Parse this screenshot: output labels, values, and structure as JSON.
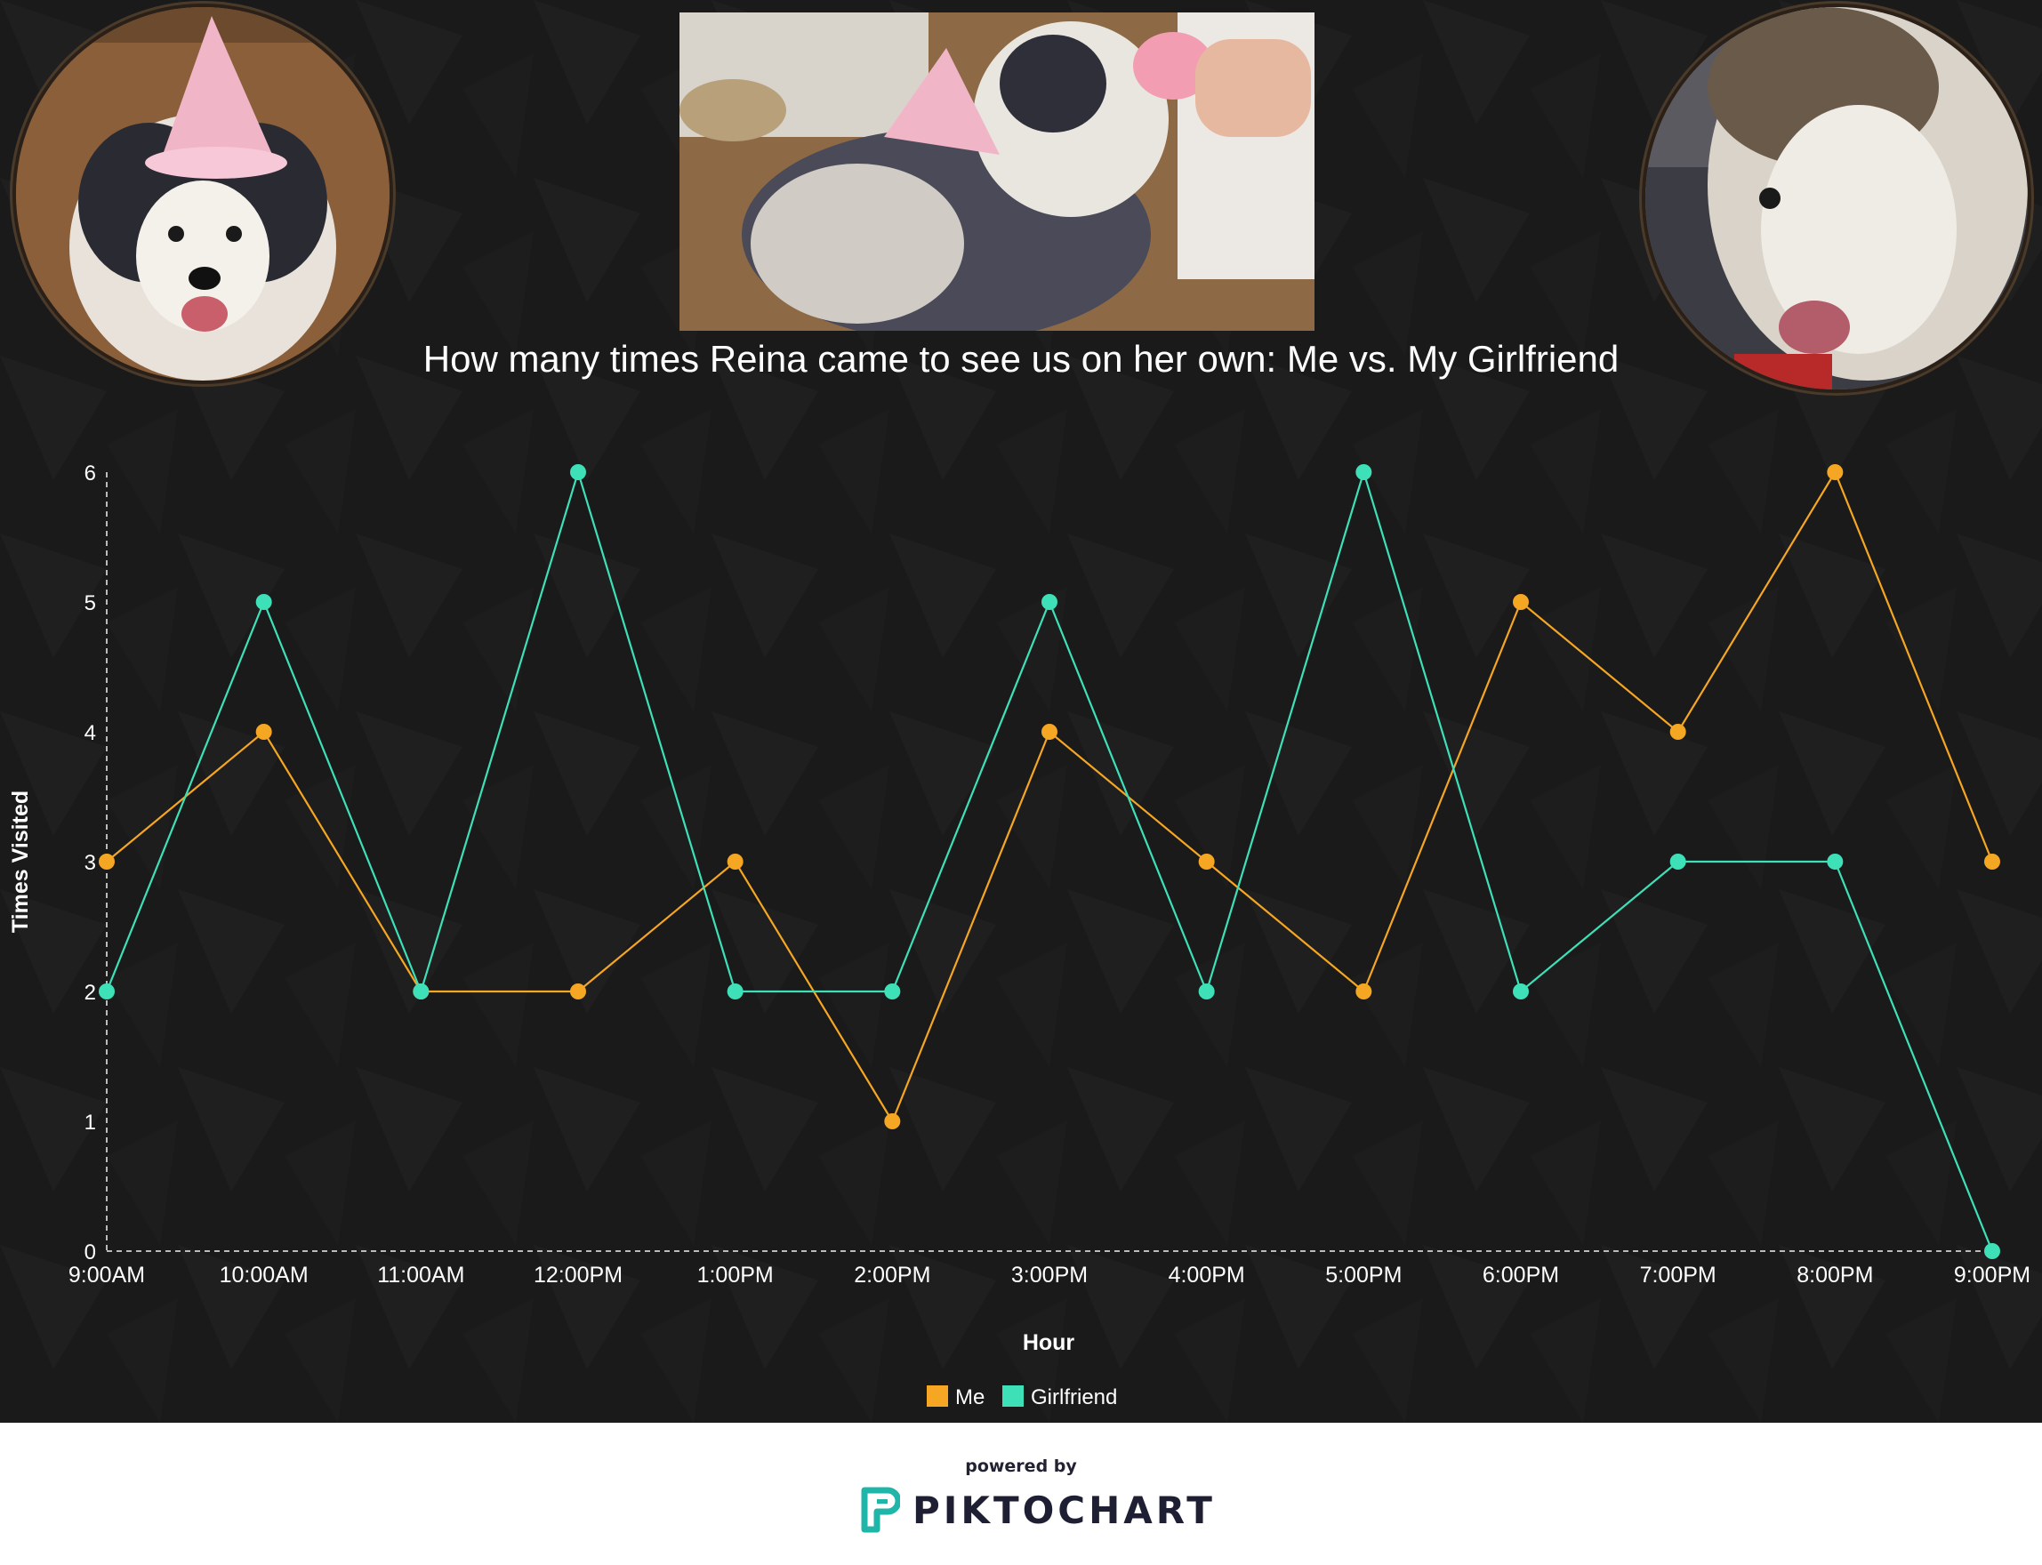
{
  "title": "How many times Reina came to see us on her own: Me vs. My Girlfriend",
  "photos": {
    "left": "Reina wearing a pink party hat",
    "center": "Reina in a party hat being offered a birthday treat",
    "right": "Reina close-up in a car"
  },
  "colors": {
    "background": "#1a1a1a",
    "me": "#f5a623",
    "girlfriend": "#3ee0b8",
    "text": "#ffffff"
  },
  "chart_data": {
    "type": "line",
    "title": "How many times Reina came to see us on her own: Me vs. My Girlfriend",
    "xlabel": "Hour",
    "ylabel": "Times Visited",
    "categories": [
      "9:00AM",
      "10:00AM",
      "11:00AM",
      "12:00PM",
      "1:00PM",
      "2:00PM",
      "3:00PM",
      "4:00PM",
      "5:00PM",
      "6:00PM",
      "7:00PM",
      "8:00PM",
      "9:00PM"
    ],
    "ylim": [
      0,
      6
    ],
    "yticks": [
      0,
      1,
      2,
      3,
      4,
      5,
      6
    ],
    "grid": false,
    "legend_position": "bottom",
    "series": [
      {
        "name": "Me",
        "color": "#f5a623",
        "values": [
          3,
          4,
          2,
          2,
          3,
          1,
          4,
          3,
          2,
          5,
          4,
          6,
          3
        ]
      },
      {
        "name": "Girlfriend",
        "color": "#3ee0b8",
        "values": [
          2,
          5,
          2,
          6,
          2,
          2,
          5,
          2,
          6,
          2,
          3,
          3,
          0
        ]
      }
    ]
  },
  "footer": {
    "powered_by": "powered by",
    "brand": "PIKTOCHART"
  }
}
